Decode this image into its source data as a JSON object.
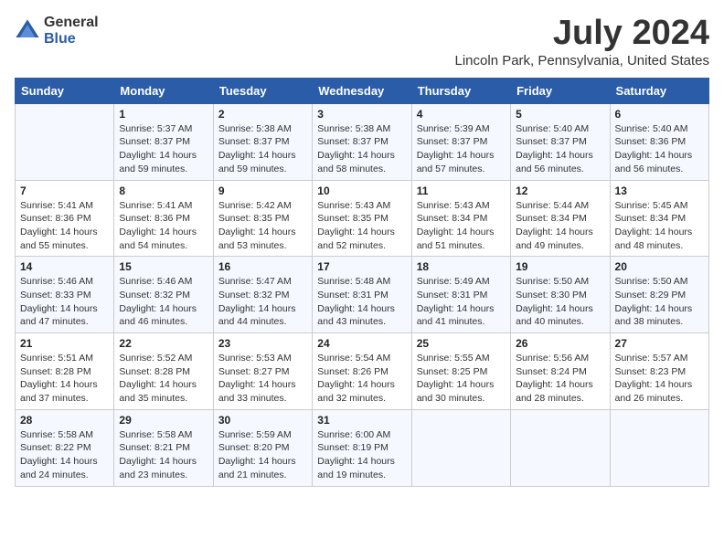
{
  "logo": {
    "general": "General",
    "blue": "Blue"
  },
  "title": "July 2024",
  "location": "Lincoln Park, Pennsylvania, United States",
  "days_of_week": [
    "Sunday",
    "Monday",
    "Tuesday",
    "Wednesday",
    "Thursday",
    "Friday",
    "Saturday"
  ],
  "weeks": [
    [
      {
        "day": "",
        "info": ""
      },
      {
        "day": "1",
        "info": "Sunrise: 5:37 AM\nSunset: 8:37 PM\nDaylight: 14 hours\nand 59 minutes."
      },
      {
        "day": "2",
        "info": "Sunrise: 5:38 AM\nSunset: 8:37 PM\nDaylight: 14 hours\nand 59 minutes."
      },
      {
        "day": "3",
        "info": "Sunrise: 5:38 AM\nSunset: 8:37 PM\nDaylight: 14 hours\nand 58 minutes."
      },
      {
        "day": "4",
        "info": "Sunrise: 5:39 AM\nSunset: 8:37 PM\nDaylight: 14 hours\nand 57 minutes."
      },
      {
        "day": "5",
        "info": "Sunrise: 5:40 AM\nSunset: 8:37 PM\nDaylight: 14 hours\nand 56 minutes."
      },
      {
        "day": "6",
        "info": "Sunrise: 5:40 AM\nSunset: 8:36 PM\nDaylight: 14 hours\nand 56 minutes."
      }
    ],
    [
      {
        "day": "7",
        "info": "Sunrise: 5:41 AM\nSunset: 8:36 PM\nDaylight: 14 hours\nand 55 minutes."
      },
      {
        "day": "8",
        "info": "Sunrise: 5:41 AM\nSunset: 8:36 PM\nDaylight: 14 hours\nand 54 minutes."
      },
      {
        "day": "9",
        "info": "Sunrise: 5:42 AM\nSunset: 8:35 PM\nDaylight: 14 hours\nand 53 minutes."
      },
      {
        "day": "10",
        "info": "Sunrise: 5:43 AM\nSunset: 8:35 PM\nDaylight: 14 hours\nand 52 minutes."
      },
      {
        "day": "11",
        "info": "Sunrise: 5:43 AM\nSunset: 8:34 PM\nDaylight: 14 hours\nand 51 minutes."
      },
      {
        "day": "12",
        "info": "Sunrise: 5:44 AM\nSunset: 8:34 PM\nDaylight: 14 hours\nand 49 minutes."
      },
      {
        "day": "13",
        "info": "Sunrise: 5:45 AM\nSunset: 8:34 PM\nDaylight: 14 hours\nand 48 minutes."
      }
    ],
    [
      {
        "day": "14",
        "info": "Sunrise: 5:46 AM\nSunset: 8:33 PM\nDaylight: 14 hours\nand 47 minutes."
      },
      {
        "day": "15",
        "info": "Sunrise: 5:46 AM\nSunset: 8:32 PM\nDaylight: 14 hours\nand 46 minutes."
      },
      {
        "day": "16",
        "info": "Sunrise: 5:47 AM\nSunset: 8:32 PM\nDaylight: 14 hours\nand 44 minutes."
      },
      {
        "day": "17",
        "info": "Sunrise: 5:48 AM\nSunset: 8:31 PM\nDaylight: 14 hours\nand 43 minutes."
      },
      {
        "day": "18",
        "info": "Sunrise: 5:49 AM\nSunset: 8:31 PM\nDaylight: 14 hours\nand 41 minutes."
      },
      {
        "day": "19",
        "info": "Sunrise: 5:50 AM\nSunset: 8:30 PM\nDaylight: 14 hours\nand 40 minutes."
      },
      {
        "day": "20",
        "info": "Sunrise: 5:50 AM\nSunset: 8:29 PM\nDaylight: 14 hours\nand 38 minutes."
      }
    ],
    [
      {
        "day": "21",
        "info": "Sunrise: 5:51 AM\nSunset: 8:28 PM\nDaylight: 14 hours\nand 37 minutes."
      },
      {
        "day": "22",
        "info": "Sunrise: 5:52 AM\nSunset: 8:28 PM\nDaylight: 14 hours\nand 35 minutes."
      },
      {
        "day": "23",
        "info": "Sunrise: 5:53 AM\nSunset: 8:27 PM\nDaylight: 14 hours\nand 33 minutes."
      },
      {
        "day": "24",
        "info": "Sunrise: 5:54 AM\nSunset: 8:26 PM\nDaylight: 14 hours\nand 32 minutes."
      },
      {
        "day": "25",
        "info": "Sunrise: 5:55 AM\nSunset: 8:25 PM\nDaylight: 14 hours\nand 30 minutes."
      },
      {
        "day": "26",
        "info": "Sunrise: 5:56 AM\nSunset: 8:24 PM\nDaylight: 14 hours\nand 28 minutes."
      },
      {
        "day": "27",
        "info": "Sunrise: 5:57 AM\nSunset: 8:23 PM\nDaylight: 14 hours\nand 26 minutes."
      }
    ],
    [
      {
        "day": "28",
        "info": "Sunrise: 5:58 AM\nSunset: 8:22 PM\nDaylight: 14 hours\nand 24 minutes."
      },
      {
        "day": "29",
        "info": "Sunrise: 5:58 AM\nSunset: 8:21 PM\nDaylight: 14 hours\nand 23 minutes."
      },
      {
        "day": "30",
        "info": "Sunrise: 5:59 AM\nSunset: 8:20 PM\nDaylight: 14 hours\nand 21 minutes."
      },
      {
        "day": "31",
        "info": "Sunrise: 6:00 AM\nSunset: 8:19 PM\nDaylight: 14 hours\nand 19 minutes."
      },
      {
        "day": "",
        "info": ""
      },
      {
        "day": "",
        "info": ""
      },
      {
        "day": "",
        "info": ""
      }
    ]
  ]
}
